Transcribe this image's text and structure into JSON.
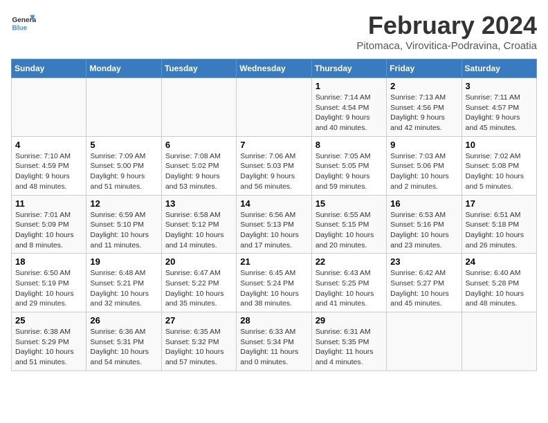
{
  "header": {
    "logo_general": "General",
    "logo_blue": "Blue",
    "title": "February 2024",
    "subtitle": "Pitomaca, Virovitica-Podravina, Croatia"
  },
  "columns": [
    "Sunday",
    "Monday",
    "Tuesday",
    "Wednesday",
    "Thursday",
    "Friday",
    "Saturday"
  ],
  "weeks": [
    [
      {
        "day": "",
        "info": ""
      },
      {
        "day": "",
        "info": ""
      },
      {
        "day": "",
        "info": ""
      },
      {
        "day": "",
        "info": ""
      },
      {
        "day": "1",
        "info": "Sunrise: 7:14 AM\nSunset: 4:54 PM\nDaylight: 9 hours and 40 minutes."
      },
      {
        "day": "2",
        "info": "Sunrise: 7:13 AM\nSunset: 4:56 PM\nDaylight: 9 hours and 42 minutes."
      },
      {
        "day": "3",
        "info": "Sunrise: 7:11 AM\nSunset: 4:57 PM\nDaylight: 9 hours and 45 minutes."
      }
    ],
    [
      {
        "day": "4",
        "info": "Sunrise: 7:10 AM\nSunset: 4:59 PM\nDaylight: 9 hours and 48 minutes."
      },
      {
        "day": "5",
        "info": "Sunrise: 7:09 AM\nSunset: 5:00 PM\nDaylight: 9 hours and 51 minutes."
      },
      {
        "day": "6",
        "info": "Sunrise: 7:08 AM\nSunset: 5:02 PM\nDaylight: 9 hours and 53 minutes."
      },
      {
        "day": "7",
        "info": "Sunrise: 7:06 AM\nSunset: 5:03 PM\nDaylight: 9 hours and 56 minutes."
      },
      {
        "day": "8",
        "info": "Sunrise: 7:05 AM\nSunset: 5:05 PM\nDaylight: 9 hours and 59 minutes."
      },
      {
        "day": "9",
        "info": "Sunrise: 7:03 AM\nSunset: 5:06 PM\nDaylight: 10 hours and 2 minutes."
      },
      {
        "day": "10",
        "info": "Sunrise: 7:02 AM\nSunset: 5:08 PM\nDaylight: 10 hours and 5 minutes."
      }
    ],
    [
      {
        "day": "11",
        "info": "Sunrise: 7:01 AM\nSunset: 5:09 PM\nDaylight: 10 hours and 8 minutes."
      },
      {
        "day": "12",
        "info": "Sunrise: 6:59 AM\nSunset: 5:10 PM\nDaylight: 10 hours and 11 minutes."
      },
      {
        "day": "13",
        "info": "Sunrise: 6:58 AM\nSunset: 5:12 PM\nDaylight: 10 hours and 14 minutes."
      },
      {
        "day": "14",
        "info": "Sunrise: 6:56 AM\nSunset: 5:13 PM\nDaylight: 10 hours and 17 minutes."
      },
      {
        "day": "15",
        "info": "Sunrise: 6:55 AM\nSunset: 5:15 PM\nDaylight: 10 hours and 20 minutes."
      },
      {
        "day": "16",
        "info": "Sunrise: 6:53 AM\nSunset: 5:16 PM\nDaylight: 10 hours and 23 minutes."
      },
      {
        "day": "17",
        "info": "Sunrise: 6:51 AM\nSunset: 5:18 PM\nDaylight: 10 hours and 26 minutes."
      }
    ],
    [
      {
        "day": "18",
        "info": "Sunrise: 6:50 AM\nSunset: 5:19 PM\nDaylight: 10 hours and 29 minutes."
      },
      {
        "day": "19",
        "info": "Sunrise: 6:48 AM\nSunset: 5:21 PM\nDaylight: 10 hours and 32 minutes."
      },
      {
        "day": "20",
        "info": "Sunrise: 6:47 AM\nSunset: 5:22 PM\nDaylight: 10 hours and 35 minutes."
      },
      {
        "day": "21",
        "info": "Sunrise: 6:45 AM\nSunset: 5:24 PM\nDaylight: 10 hours and 38 minutes."
      },
      {
        "day": "22",
        "info": "Sunrise: 6:43 AM\nSunset: 5:25 PM\nDaylight: 10 hours and 41 minutes."
      },
      {
        "day": "23",
        "info": "Sunrise: 6:42 AM\nSunset: 5:27 PM\nDaylight: 10 hours and 45 minutes."
      },
      {
        "day": "24",
        "info": "Sunrise: 6:40 AM\nSunset: 5:28 PM\nDaylight: 10 hours and 48 minutes."
      }
    ],
    [
      {
        "day": "25",
        "info": "Sunrise: 6:38 AM\nSunset: 5:29 PM\nDaylight: 10 hours and 51 minutes."
      },
      {
        "day": "26",
        "info": "Sunrise: 6:36 AM\nSunset: 5:31 PM\nDaylight: 10 hours and 54 minutes."
      },
      {
        "day": "27",
        "info": "Sunrise: 6:35 AM\nSunset: 5:32 PM\nDaylight: 10 hours and 57 minutes."
      },
      {
        "day": "28",
        "info": "Sunrise: 6:33 AM\nSunset: 5:34 PM\nDaylight: 11 hours and 0 minutes."
      },
      {
        "day": "29",
        "info": "Sunrise: 6:31 AM\nSunset: 5:35 PM\nDaylight: 11 hours and 4 minutes."
      },
      {
        "day": "",
        "info": ""
      },
      {
        "day": "",
        "info": ""
      }
    ]
  ]
}
